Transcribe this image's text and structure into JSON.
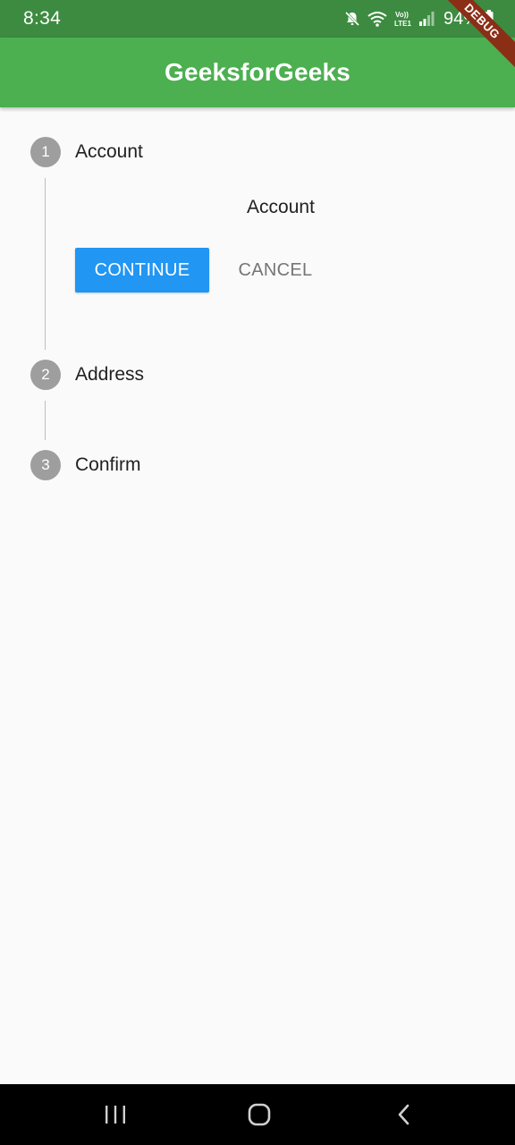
{
  "status_bar": {
    "time": "8:34",
    "battery": "94%",
    "icons": [
      "mute-icon",
      "wifi-icon",
      "volte-icon",
      "signal-icon",
      "battery-icon"
    ],
    "volte_text": "Vo)) LTE1"
  },
  "app_bar": {
    "title": "GeeksforGeeks",
    "color": "#4caf50"
  },
  "debug_banner": {
    "label": "DEBUG"
  },
  "stepper": {
    "steps": [
      {
        "number": "1",
        "label": "Account"
      },
      {
        "number": "2",
        "label": "Address"
      },
      {
        "number": "3",
        "label": "Confirm"
      }
    ],
    "active_content": "Account",
    "continue_label": "CONTINUE",
    "cancel_label": "CANCEL",
    "accent_color": "#2196f3"
  },
  "nav_bar": {
    "buttons": [
      "recents-icon",
      "home-icon",
      "back-icon"
    ]
  }
}
